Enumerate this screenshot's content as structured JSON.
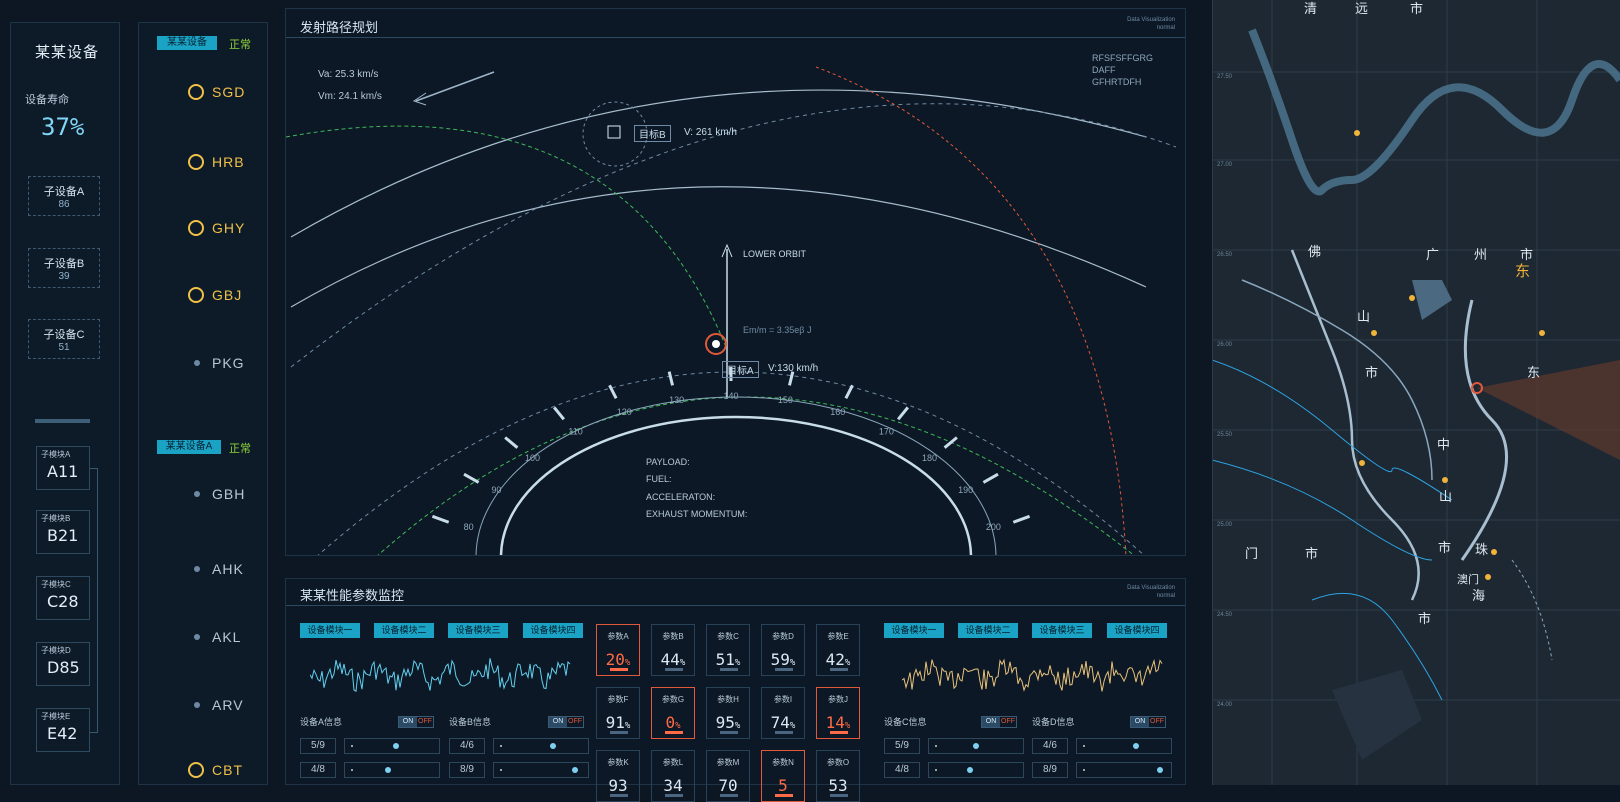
{
  "left_panel": {
    "title": "某某设备",
    "life_label": "设备寿命",
    "life_value": "37%",
    "sub_devices": [
      {
        "label": "子设备A",
        "value": "86"
      },
      {
        "label": "子设备B",
        "value": "39"
      },
      {
        "label": "子设备C",
        "value": "51"
      }
    ],
    "modules": [
      {
        "label": "子模块A",
        "value": "A11"
      },
      {
        "label": "子模块B",
        "value": "B21"
      },
      {
        "label": "子模块C",
        "value": "C28"
      },
      {
        "label": "子模块D",
        "value": "D85"
      },
      {
        "label": "子模块E",
        "value": "E42"
      }
    ]
  },
  "station_list": {
    "group1": {
      "device_label": "某某设备",
      "status": "正常",
      "items": [
        {
          "code": "SGD",
          "active": true
        },
        {
          "code": "HRB",
          "active": true
        },
        {
          "code": "GHY",
          "active": true
        },
        {
          "code": "GBJ",
          "active": true
        },
        {
          "code": "PKG",
          "active": false
        }
      ]
    },
    "group2": {
      "device_label": "某某设备A",
      "status": "正常",
      "items": [
        {
          "code": "GBH",
          "active": false
        },
        {
          "code": "AHK",
          "active": false
        },
        {
          "code": "AKL",
          "active": false
        },
        {
          "code": "ARV",
          "active": false
        },
        {
          "code": "CBT",
          "active": true
        }
      ]
    }
  },
  "launch_panel": {
    "title": "发射路径规划",
    "corner_tag": "Data Visualization",
    "corner_sub": "normal",
    "va": "Va: 25.3 km/s",
    "vm": "Vm: 24.1 km/s",
    "top_right_lines": [
      "RFSFSFFGRG",
      "DAFF",
      "GFHRTDFH"
    ],
    "target_b": "目标B",
    "target_b_speed": "V: 261  km/h",
    "lower_orbit": "LOWER ORBIT",
    "em": "Em/m = 3.35eβ J",
    "target_a": "目标A",
    "target_a_speed": "V:130  km/h",
    "dial_ticks": [
      "80",
      "90",
      "100",
      "110",
      "120",
      "130",
      "140",
      "150",
      "160",
      "170",
      "180",
      "190",
      "200"
    ],
    "payload_labels": [
      "PAYLOAD:",
      "FUEL:",
      "ACCELERATON:",
      "EXHAUST MOMENTUM:"
    ]
  },
  "monitor_panel": {
    "title": "某某性能参数监控",
    "corner_tag": "Data Visualization",
    "corner_sub": "normal",
    "left_modules": [
      "设备模块一",
      "设备模块二",
      "设备模块三",
      "设备模块四"
    ],
    "right_modules": [
      "设备模块一",
      "设备模块二",
      "设备模块三",
      "设备模块四"
    ],
    "info_left": [
      "设备A信息",
      "设备B信息"
    ],
    "info_right": [
      "设备C信息",
      "设备D信息"
    ],
    "on": "ON",
    "off": "OFF",
    "ratios_left": [
      "5/9",
      "4/8"
    ],
    "ratios_left2": [
      "4/6",
      "8/9"
    ],
    "ratios_right": [
      "5/9",
      "4/8"
    ],
    "ratios_right2": [
      "4/6",
      "8/9"
    ],
    "params": [
      {
        "label": "参数A",
        "value": "20",
        "unit": "%",
        "hot": true
      },
      {
        "label": "参数B",
        "value": "44",
        "unit": "%",
        "hot": false
      },
      {
        "label": "参数C",
        "value": "51",
        "unit": "%",
        "hot": false
      },
      {
        "label": "参数D",
        "value": "59",
        "unit": "%",
        "hot": false
      },
      {
        "label": "参数E",
        "value": "42",
        "unit": "%",
        "hot": false
      },
      {
        "label": "参数F",
        "value": "91",
        "unit": "%",
        "hot": false
      },
      {
        "label": "参数G",
        "value": "0",
        "unit": "%",
        "hot": true
      },
      {
        "label": "参数H",
        "value": "95",
        "unit": "%",
        "hot": false
      },
      {
        "label": "参数I",
        "value": "74",
        "unit": "%",
        "hot": false
      },
      {
        "label": "参数J",
        "value": "14",
        "unit": "%",
        "hot": true
      },
      {
        "label": "参数K",
        "value": "93",
        "unit": "",
        "hot": false
      },
      {
        "label": "参数L",
        "value": "34",
        "unit": "",
        "hot": false
      },
      {
        "label": "参数M",
        "value": "70",
        "unit": "",
        "hot": false
      },
      {
        "label": "参数N",
        "value": "5",
        "unit": "",
        "hot": true
      },
      {
        "label": "参数O",
        "value": "53",
        "unit": "",
        "hot": false
      }
    ]
  },
  "map": {
    "labels": [
      "清",
      "远",
      "市",
      "佛",
      "广",
      "州",
      "市",
      "东",
      "山",
      "市",
      "东",
      "中",
      "山",
      "市",
      "珠",
      "门",
      "市",
      "澳门",
      "海",
      "市"
    ],
    "ticks": [
      "27.50",
      "27.00",
      "26.50",
      "26.00",
      "25.50",
      "25.00",
      "24.50",
      "24.00"
    ]
  },
  "colors": {
    "accent": "#1aa3c4",
    "ok": "#8fd33a",
    "warn": "#ff6b46",
    "gold": "#f0c048"
  }
}
